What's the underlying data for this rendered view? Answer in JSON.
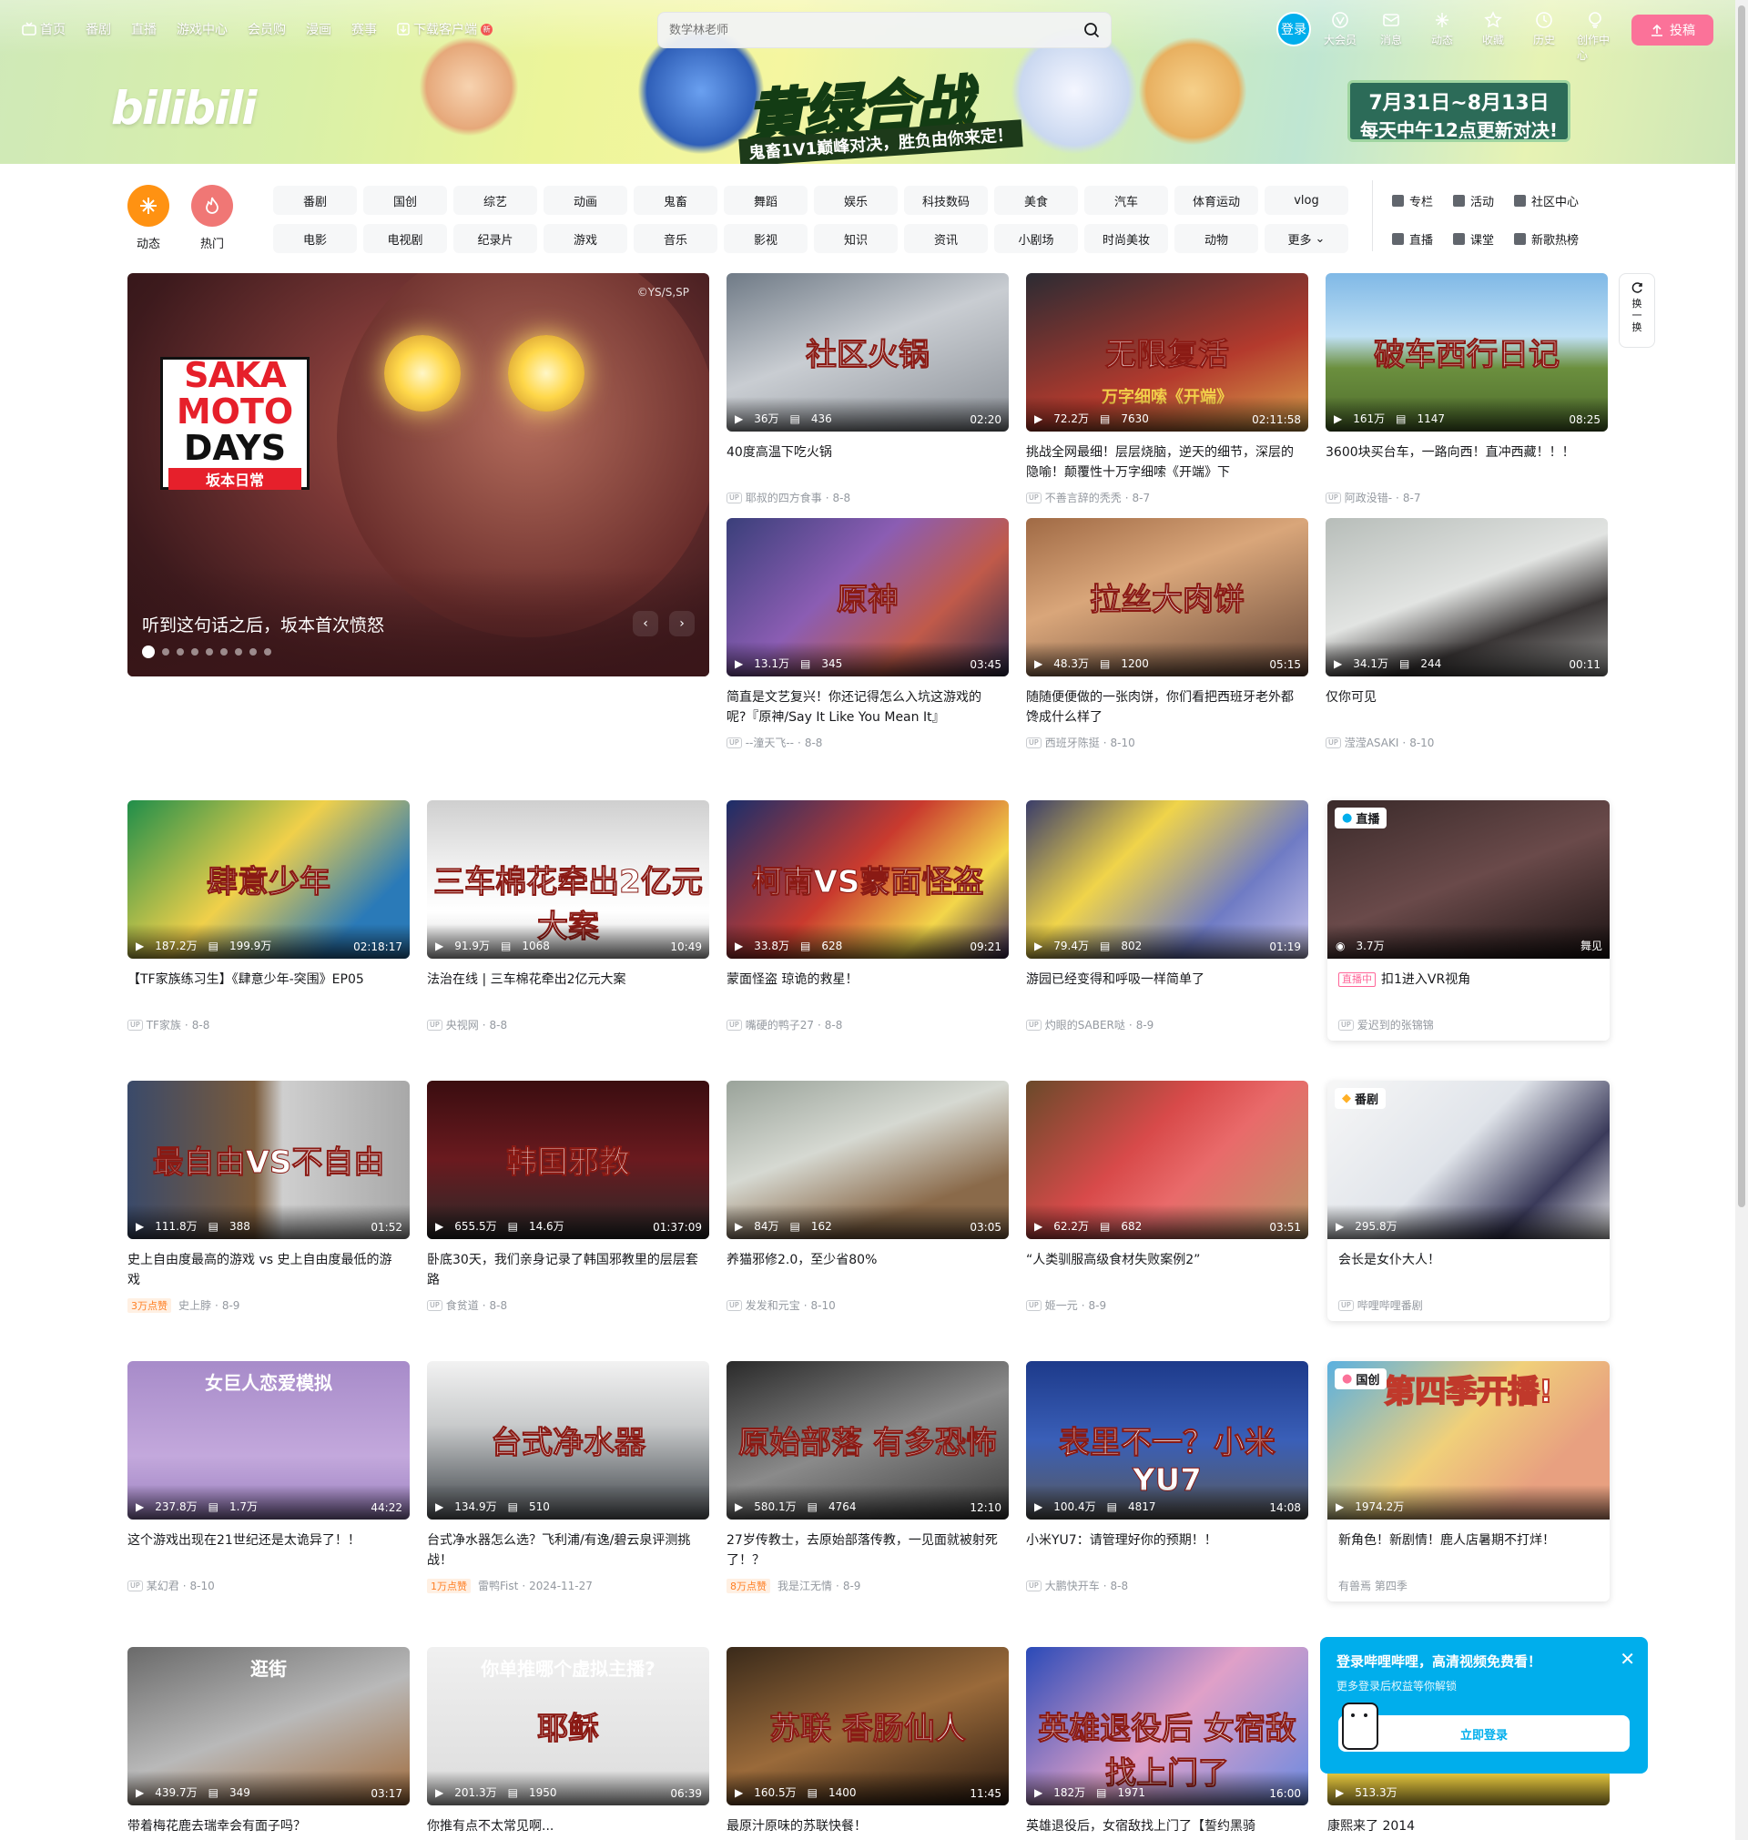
{
  "topnav": {
    "items": [
      "首页",
      "番剧",
      "直播",
      "游戏中心",
      "会员购",
      "漫画",
      "赛事"
    ],
    "download": "下载客户端",
    "new_tag": "新"
  },
  "search": {
    "placeholder": "数学林老师"
  },
  "login_label": "登录",
  "rightnav": [
    "大会员",
    "消息",
    "动态",
    "收藏",
    "历史",
    "创作中心"
  ],
  "upload_label": "投稿",
  "banner": {
    "logo": "bilibili",
    "title": "黄绿合战",
    "subtitle": "鬼畜1V1巅峰对决，胜负由你来定！",
    "date_line1": "7月31日~8月13日",
    "date_line2": "每天中午12点更新对决!"
  },
  "channels": {
    "dynamic": "动态",
    "hot": "热门",
    "grid": [
      "番剧",
      "国创",
      "综艺",
      "动画",
      "鬼畜",
      "舞蹈",
      "娱乐",
      "科技数码",
      "美食",
      "汽车",
      "体育运动",
      "vlog",
      "电影",
      "电视剧",
      "纪录片",
      "游戏",
      "音乐",
      "影视",
      "知识",
      "资讯",
      "小剧场",
      "时尚美妆",
      "动物",
      "更多"
    ],
    "right": [
      "专栏",
      "活动",
      "社区中心",
      "直播",
      "课堂",
      "新歌热榜"
    ]
  },
  "carousel": {
    "caption": "听到这句话之后，坂本首次愤怒",
    "copyright": "©YS/S,SP",
    "logo_l1": "SAKA",
    "logo_l2": "MOTO",
    "logo_l3": "DAYS",
    "logo_cn": "坂本日常",
    "dots": 9
  },
  "refresh_label": [
    "换",
    "一",
    "换"
  ],
  "cards": [
    {
      "cover": "社区火锅",
      "views": "36万",
      "danmaku": "436",
      "dur": "02:20",
      "title": "40度高温下吃火锅",
      "up": "耶叔的四方食事",
      "date": "8-8",
      "bg": "linear-gradient(160deg,#6f7a86,#c9cdd2 45%,#8a8f96)"
    },
    {
      "cover": "无限复活",
      "sub": "万字细嗦《开端》",
      "views": "72.2万",
      "danmaku": "7630",
      "dur": "02:11:58",
      "title": "挑战全网最细！层层烧脑，逆天的细节，深层的隐喻！颠覆性十万字细嗦《开端》下",
      "up": "不善言辞的秃秃",
      "date": "8-7",
      "bg": "linear-gradient(160deg,#2b2b33,#b43a2d 60%,#d9a24b)"
    },
    {
      "cover": "破车西行日记",
      "views": "161万",
      "danmaku": "1147",
      "dur": "08:25",
      "title": "3600块买台车，一路向西！直冲西藏！！！",
      "up": "阿政没错-",
      "date": "8-7",
      "bg": "linear-gradient(180deg,#7fb8e6,#bfe0f4 40%,#6b8f3e 60%,#4d6b2c)"
    },
    {
      "cover": "原神",
      "views": "13.1万",
      "danmaku": "345",
      "dur": "03:45",
      "title": "简直是文艺复兴！你还记得怎么入坑这游戏的呢?『原神/Say It Like You Mean It』",
      "up": "--潼天飞--",
      "date": "8-8",
      "bg": "linear-gradient(135deg,#3a3f7a,#8b5db3 40%,#c05a4a 70%,#2c2a4a)"
    },
    {
      "cover": "拉丝大肉饼",
      "views": "48.3万",
      "danmaku": "1200",
      "dur": "05:15",
      "title": "随随便便做的一张肉饼，你们看把西班牙老外都馋成什么样了",
      "up": "西班牙陈挺",
      "date": "8-10",
      "bg": "linear-gradient(160deg,#a06a45,#d9a67a 40%,#6a4a3a)"
    },
    {
      "cover": "",
      "views": "34.1万",
      "danmaku": "244",
      "dur": "00:11",
      "title": "仅你可见",
      "up": "滢滢ASAKI",
      "date": "8-10",
      "bg": "linear-gradient(160deg,#b7bdb9,#e2e4e2 45%,#3a3636 70%,#9a9a98)"
    },
    {
      "cover": "肆意少年",
      "views": "187.2万",
      "danmaku": "199.9万",
      "dur": "02:18:17",
      "title": "【TF家族练习生】《肆意少年-突围》EP05",
      "up": "TF家族",
      "date": "8-8",
      "bg": "linear-gradient(135deg,#1f8e4a,#f0d04a 45%,#2a7ab8 80%)"
    },
    {
      "cover": "三车棉花牵出2亿元大案",
      "views": "91.9万",
      "danmaku": "1068",
      "dur": "10:49",
      "title": "法治在线 | 三车棉花牵出2亿元大案",
      "up": "央视网",
      "date": "8-8",
      "bg": "linear-gradient(180deg,#cfcfcf,#efefef 40%,#ffffff 70%,#d6d6d6)"
    },
    {
      "cover": "柯南VS蒙面怪盗",
      "views": "33.8万",
      "danmaku": "628",
      "dur": "09:21",
      "title": "蒙面怪盗 琼诡的救星！",
      "up": "嘴硬的鸭子27",
      "date": "8-8",
      "bg": "linear-gradient(135deg,#1b2e6b,#c93a2e 45%,#f3d64a 75%,#3b2a5a)"
    },
    {
      "cover": "",
      "views": "79.4万",
      "danmaku": "802",
      "dur": "01:19",
      "title": "游园已经变得和呼吸一样简单了",
      "up": "灼眼的SABER哒",
      "date": "8-9",
      "bg": "linear-gradient(135deg,#3a3d6a,#f0d44a 35%,#6f7bc4 70%,#c7c3ea)"
    },
    {
      "cover": "最自由VS不自由",
      "views": "111.8万",
      "danmaku": "388",
      "dur": "01:52",
      "title": "史上自由度最高的游戏 vs 史上自由度最低的游戏",
      "like": "3万点赞",
      "up": "史上脖",
      "date": "8-9",
      "bg": "linear-gradient(90deg,#3a4a6a,#7a5a3a 45%,#cfcfcf 55%,#a8a8a8)"
    },
    {
      "cover": "韩国邪教",
      "views": "655.5万",
      "danmaku": "14.6万",
      "dur": "01:37:09",
      "title": "卧底30天，我们亲身记录了韩国邪教里的层层套路",
      "up": "食贫道",
      "date": "8-8",
      "bg": "linear-gradient(180deg,#3a0d10,#6a1a1f 50%,#2a2a2a)"
    },
    {
      "cover": "",
      "views": "84万",
      "danmaku": "162",
      "dur": "03:05",
      "title": "养猫邪修2.0，至少省80%",
      "up": "发发和元宝",
      "date": "8-10",
      "bg": "linear-gradient(160deg,#9aa39a,#d6d9d2 40%,#8a6a4a 75%)"
    },
    {
      "cover": "",
      "views": "62.2万",
      "danmaku": "682",
      "dur": "03:51",
      "title": "“人类驯服高级食材失败案例2”",
      "up": "姬一元",
      "date": "8-9",
      "bg": "linear-gradient(135deg,#6a4a2a,#d84a4a 40%,#e96a6a 60%,#b9976a)"
    },
    {
      "cover": "",
      "views": "237.8万",
      "danmaku": "1.7万",
      "dur": "44:22",
      "title": "这个游戏出现在21世纪还是太诡异了！！",
      "up": "某幻君",
      "date": "8-10",
      "bg": "linear-gradient(180deg,#a78bc9,#c3a8dc 60%,#9a7fbf)",
      "sub2": "女巨人恋爱模拟"
    },
    {
      "cover": "台式净水器",
      "views": "134.9万",
      "danmaku": "510",
      "dur": "",
      "title": "台式净水器怎么选？飞利浦/有逸/碧云泉评测挑战！",
      "like": "1万点赞",
      "up": "雷鸭Fist",
      "date": "2024-11-27",
      "bg": "linear-gradient(180deg,#f2f2f2,#c9cbcc 40%,#6a6e72 80%)"
    },
    {
      "cover": "原始部落 有多恐怖",
      "views": "580.1万",
      "danmaku": "4764",
      "dur": "12:10",
      "title": "27岁传教士，去原始部落传教，一见面就被射死了！？",
      "like": "8万点赞",
      "up": "我是江无情",
      "date": "8-9",
      "bg": "linear-gradient(160deg,#2a2a2a,#8a8a8a 50%,#3a3a3a)"
    },
    {
      "cover": "表里不一？小米YU7",
      "views": "100.4万",
      "danmaku": "4817",
      "dur": "14:08",
      "title": "小米YU7：请管理好你的预期！！",
      "up": "大鹏快开车",
      "date": "8-8",
      "bg": "linear-gradient(180deg,#1d3a8a,#3a5fb8 50%,#5a5a5a)"
    },
    {
      "cover": "",
      "views": "439.7万",
      "danmaku": "349",
      "dur": "03:17",
      "title": "带着梅花鹿去瑞幸会有面子吗？",
      "up": "",
      "date": "",
      "bg": "linear-gradient(160deg,#6a6a6a,#b9b9b9 50%,#a06a3a)",
      "sub2": "逛街"
    },
    {
      "cover": "耶稣",
      "views": "201.3万",
      "danmaku": "1950",
      "dur": "06:39",
      "title": "你推有点不太常见啊...",
      "up": "",
      "date": "",
      "bg": "linear-gradient(180deg,#f0f0f0,#dcdcdc)",
      "sub2": "你单推哪个虚拟主播?"
    },
    {
      "cover": "苏联 香肠仙人",
      "views": "160.5万",
      "danmaku": "1400",
      "dur": "11:45",
      "title": "最原汁原味的苏联快餐！",
      "up": "",
      "date": "",
      "bg": "linear-gradient(160deg,#3a2a1a,#9a6a3a 50%,#2a1a10)"
    },
    {
      "cover": "英雄退役后 女宿敌找上门了",
      "views": "182万",
      "danmaku": "1971",
      "dur": "16:00",
      "title": "英雄退役后，女宿敌找上门了【誓约黑骑",
      "up": "",
      "date": "",
      "bg": "linear-gradient(135deg,#2a4ab8,#e0a0c8 50%,#6a8ae0)"
    }
  ],
  "live_card": {
    "badge": "直播",
    "viewers": "3.7万",
    "area": "舞见",
    "live_tag": "直播中",
    "title": "扣1进入VR视角",
    "up": "爱迟到的张锦锦",
    "bg": "linear-gradient(160deg,#3a2a2a,#6a4a4a 50%,#1a1212)"
  },
  "bangumi_card": {
    "badge": "番剧",
    "views": "295.8万",
    "title": "会长是女仆大人！",
    "up": "哔哩哔哩番剧",
    "bg": "linear-gradient(135deg,#f7f7f7,#e0e4ea 45%,#3a3a5a 75%,#f0f0f0)"
  },
  "guochuang_card": {
    "badge": "国创",
    "cover": "第四季开播!",
    "views": "1974.2万",
    "title": "新角色！新剧情！鹿人店暑期不打烊！",
    "meta": "有兽焉 第四季",
    "bg": "linear-gradient(135deg,#5ab0e0,#f0d07a 45%,#e8a080 75%)"
  },
  "last_card": {
    "views": "513.3万",
    "title": "康熙来了 2014",
    "bg": "linear-gradient(180deg,#2a2a2a,#f0d040 80%)"
  },
  "popup": {
    "title": "登录哔哩哔哩，高清视频免费看！",
    "sub": "更多登录后权益等你解锁",
    "button": "立即登录"
  }
}
